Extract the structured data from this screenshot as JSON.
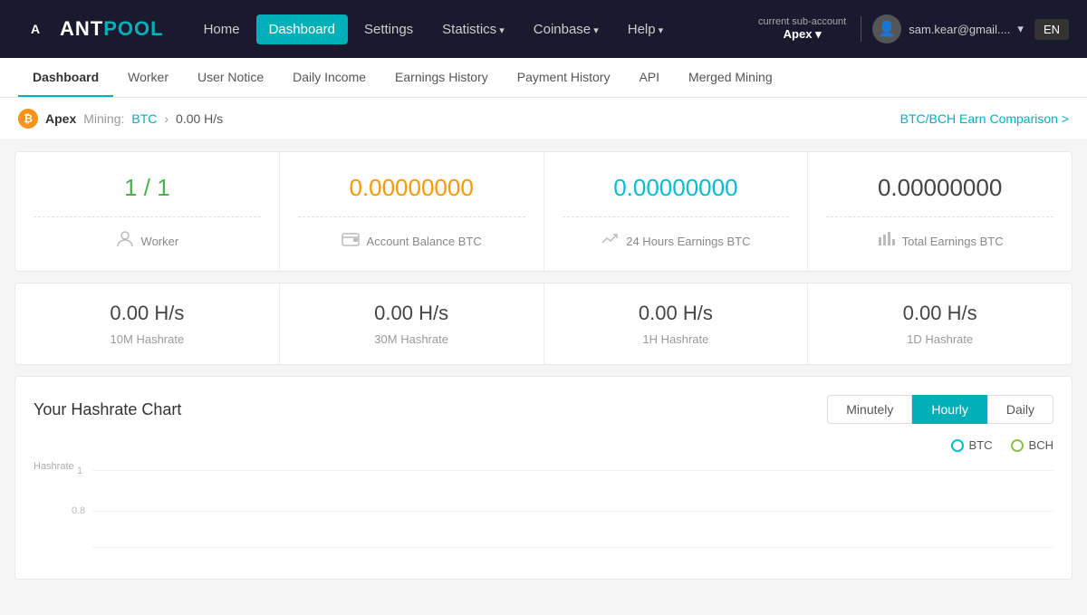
{
  "nav": {
    "logo_ant": "ANT",
    "logo_pool": "POOL",
    "links": [
      {
        "label": "Home",
        "active": false
      },
      {
        "label": "Dashboard",
        "active": true
      },
      {
        "label": "Settings",
        "active": false
      },
      {
        "label": "Statistics",
        "active": false,
        "dropdown": true
      },
      {
        "label": "Coinbase",
        "active": false,
        "dropdown": true
      },
      {
        "label": "Help",
        "active": false,
        "dropdown": true
      }
    ],
    "sub_account_label": "current sub-account",
    "sub_account_name": "Apex",
    "user_email": "sam.kear@gmail....",
    "lang": "EN"
  },
  "sub_nav": {
    "items": [
      {
        "label": "Dashboard",
        "active": true
      },
      {
        "label": "Worker",
        "active": false
      },
      {
        "label": "User Notice",
        "active": false
      },
      {
        "label": "Daily Income",
        "active": false
      },
      {
        "label": "Earnings History",
        "active": false
      },
      {
        "label": "Payment History",
        "active": false
      },
      {
        "label": "API",
        "active": false
      },
      {
        "label": "Merged Mining",
        "active": false
      }
    ]
  },
  "breadcrumb": {
    "apex": "Apex",
    "mining_label": "Mining:",
    "btc": "BTC",
    "hashrate": "0.00 H/s",
    "comparison_link": "BTC/BCH Earn Comparison >"
  },
  "stats": [
    {
      "value": "1 / 1",
      "color": "green",
      "icon": "👤",
      "label": "Worker"
    },
    {
      "value": "0.00000000",
      "color": "orange",
      "icon": "💳",
      "label": "Account Balance BTC"
    },
    {
      "value": "0.00000000",
      "color": "teal",
      "icon": "📈",
      "label": "24 Hours Earnings BTC"
    },
    {
      "value": "0.00000000",
      "color": "dark",
      "icon": "📊",
      "label": "Total Earnings BTC"
    }
  ],
  "hashrates": [
    {
      "value": "0.00 H/s",
      "label": "10M Hashrate"
    },
    {
      "value": "0.00 H/s",
      "label": "30M Hashrate"
    },
    {
      "value": "0.00 H/s",
      "label": "1H Hashrate"
    },
    {
      "value": "0.00 H/s",
      "label": "1D Hashrate"
    }
  ],
  "chart": {
    "title": "Your Hashrate Chart",
    "y_axis_label": "Hashrate",
    "y_axis_values": [
      "1",
      "0.8"
    ],
    "buttons": [
      {
        "label": "Minutely",
        "active": false
      },
      {
        "label": "Hourly",
        "active": true
      },
      {
        "label": "Daily",
        "active": false
      }
    ],
    "legend": [
      {
        "label": "BTC",
        "color": "btc"
      },
      {
        "label": "BCH",
        "color": "bch"
      }
    ]
  }
}
